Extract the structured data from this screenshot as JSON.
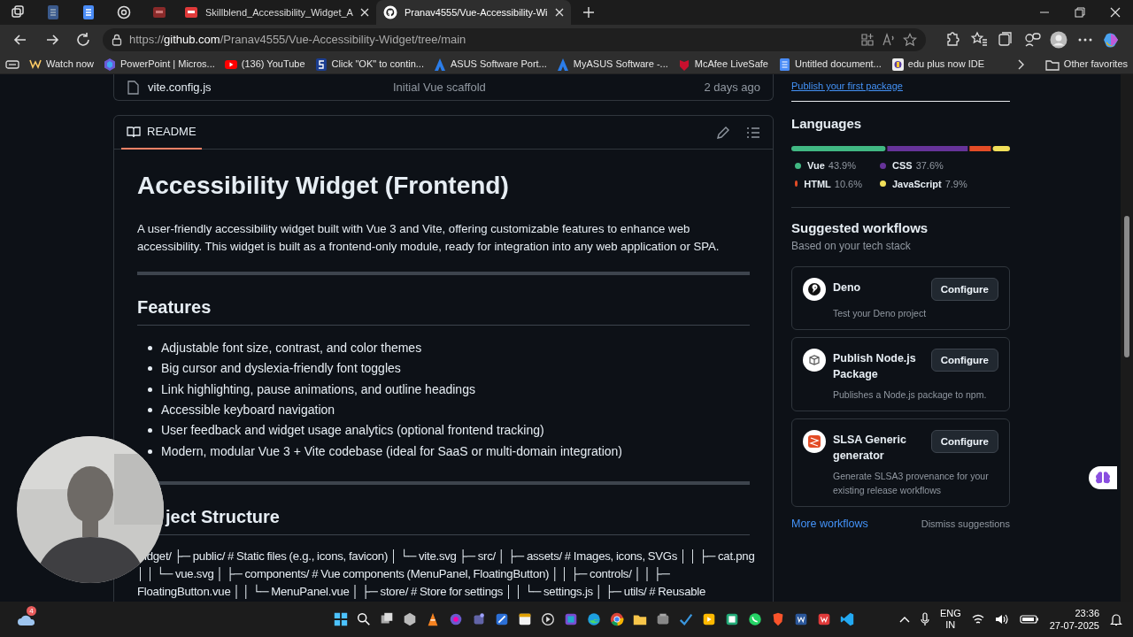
{
  "browser": {
    "tabs": [
      {
        "title": "Skillblend_Accessibility_Widget_A",
        "kind": "pdf",
        "selected": false
      },
      {
        "title": "Pranav4555/Vue-Accessibility-Wi",
        "kind": "github",
        "selected": true
      }
    ],
    "url": {
      "scheme": "https://",
      "host": "github.com",
      "path": "/Pranav4555/Vue-Accessibility-Widget/tree/main"
    },
    "bookmarks": [
      {
        "label": "Watch now",
        "kind": "watch"
      },
      {
        "label": "PowerPoint | Micros...",
        "kind": "powerpoint"
      },
      {
        "label": "(136) YouTube",
        "kind": "youtube"
      },
      {
        "label": "Click \"OK\" to contin...",
        "kind": "s"
      },
      {
        "label": "ASUS Software Port...",
        "kind": "asus"
      },
      {
        "label": "MyASUS Software -...",
        "kind": "asus"
      },
      {
        "label": "McAfee LiveSafe",
        "kind": "mcafee"
      },
      {
        "label": "Untitled document...",
        "kind": "docs"
      },
      {
        "label": "edu plus now IDE",
        "kind": "edu"
      }
    ],
    "other_favorites": "Other favorites"
  },
  "file_row": {
    "name": "vite.config.js",
    "commit": "Initial Vue scaffold",
    "time": "2 days ago"
  },
  "readme": {
    "tab": "README",
    "tab_selected": true,
    "title": "Accessibility Widget (Frontend)",
    "intro": "A user-friendly accessibility widget built with Vue 3 and Vite, offering customizable features to enhance web accessibility. This widget is built as a frontend-only module, ready for integration into any web application or SPA.",
    "features_heading": "Features",
    "features": [
      "Adjustable font size, contrast, and color themes",
      "Big cursor and dyslexia-friendly font toggles",
      "Link highlighting, pause animations, and outline headings",
      "Accessible keyboard navigation",
      "User feedback and widget usage analytics (optional frontend tracking)",
      "Modern, modular Vue 3 + Vite codebase (ideal for SaaS or multi-domain integration)"
    ],
    "structure_heading": "ject Structure",
    "structure_text": "idget/ ├─ public/ # Static files (e.g., icons, favicon) │ └─ vite.svg ├─ src/ │ ├─ assets/ # Images, icons, SVGs │ │ ├─ cat.png │ │ └─ vue.svg │ ├─ components/ # Vue components (MenuPanel, FloatingButton) │ │ ├─ controls/ │ │ ├─ FloatingButton.vue │ │ └─ MenuPanel.vue │ ├─ store/ # Store for settings │ │ └─ settings.js │ ├─ utils/ # Reusable"
  },
  "sidebar": {
    "publish_link": "Publish your first package",
    "languages_heading": "Languages",
    "languages": [
      {
        "name": "Vue",
        "percent": "43.9%",
        "color": "#41b883"
      },
      {
        "name": "CSS",
        "percent": "37.6%",
        "color": "#663399"
      },
      {
        "name": "HTML",
        "percent": "10.6%",
        "color": "#e34c26"
      },
      {
        "name": "JavaScript",
        "percent": "7.9%",
        "color": "#f1e05a"
      }
    ],
    "workflows_heading": "Suggested workflows",
    "workflows_subtitle": "Based on your tech stack",
    "workflows": [
      {
        "name": "Deno",
        "description": "Test your Deno project",
        "button": "Configure",
        "kind": "deno"
      },
      {
        "name": "Publish Node.js Package",
        "description": "Publishes a Node.js package to npm.",
        "button": "Configure",
        "kind": "package"
      },
      {
        "name": "SLSA Generic generator",
        "description": "Generate SLSA3 provenance for your existing release workflows",
        "button": "Configure",
        "kind": "slsa"
      }
    ],
    "more_link": "More workflows",
    "dismiss": "Dismiss suggestions"
  },
  "taskbar": {
    "weather_badge": "4",
    "lang_top": "ENG",
    "lang_bottom": "IN",
    "time": "23:36",
    "date": "27-07-2025"
  }
}
